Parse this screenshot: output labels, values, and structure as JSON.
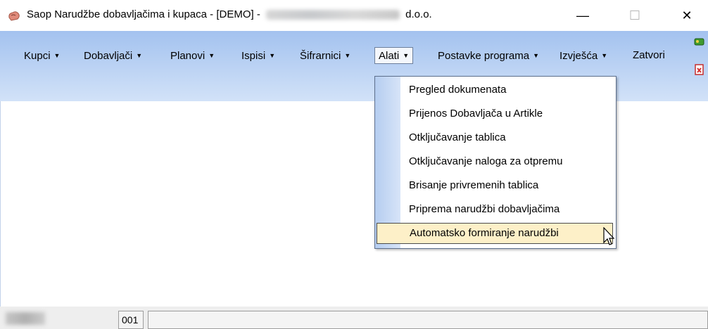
{
  "window": {
    "title_prefix": "Saop  Narudžbe dobavljačima i kupaca -  [DEMO] -",
    "title_suffix": "d.o.o.",
    "minimize": "—",
    "maximize": "☐",
    "close": "✕"
  },
  "menu": {
    "items": [
      {
        "label": "Kupci"
      },
      {
        "label": "Dobavljači"
      },
      {
        "label": "Planovi"
      },
      {
        "label": "Ispisi"
      },
      {
        "label": "Šifrarnici"
      },
      {
        "label": "Alati"
      },
      {
        "label": "Postavke programa"
      },
      {
        "label": "Izvješća"
      },
      {
        "label": "Zatvori"
      }
    ],
    "arrow": "▼",
    "active": "Alati"
  },
  "dropdown": {
    "items": [
      {
        "label": "Pregled dokumenata"
      },
      {
        "label": "Prijenos Dobavljača u Artikle"
      },
      {
        "label": "Otključavanje tablica"
      },
      {
        "label": "Otključavanje naloga za otpremu"
      },
      {
        "label": "Brisanje privremenih tablica"
      },
      {
        "label": "Priprema narudžbi dobavljačima"
      },
      {
        "label": "Automatsko formiranje narudžbi"
      }
    ],
    "highlighted": "Automatsko formiranje narudžbi"
  },
  "status": {
    "code": "001",
    "main": ""
  },
  "icons": {
    "app": "saop-app-icon",
    "side_top": "green-tool-icon",
    "side_bottom": "red-document-icon",
    "cursor": "mouse-pointer-icon"
  },
  "colors": {
    "menubar_top": "#a3c2ef",
    "menubar_bottom": "#d2e2f8",
    "highlight": "#fdf0c8"
  }
}
